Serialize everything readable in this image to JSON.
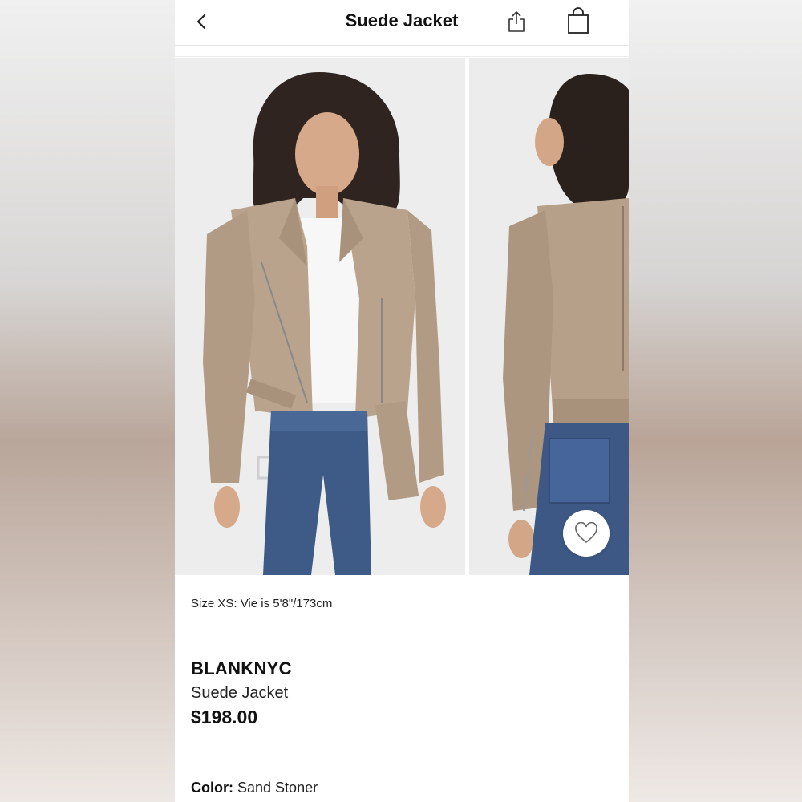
{
  "header": {
    "title": "Suede Jacket"
  },
  "product": {
    "size_note": "Size XS: Vie is 5'8\"/173cm",
    "brand": "BLANKNYC",
    "name": "Suede Jacket",
    "price": "$198.00",
    "color_label": "Color:",
    "color_value": "Sand Stoner"
  },
  "icons": [
    "back-icon",
    "share-icon",
    "shopping-bag-icon",
    "heart-icon"
  ],
  "colors": {
    "jacket": "#b9a38d",
    "denim": "#3e5a86",
    "photo_bg": "#ececec"
  }
}
